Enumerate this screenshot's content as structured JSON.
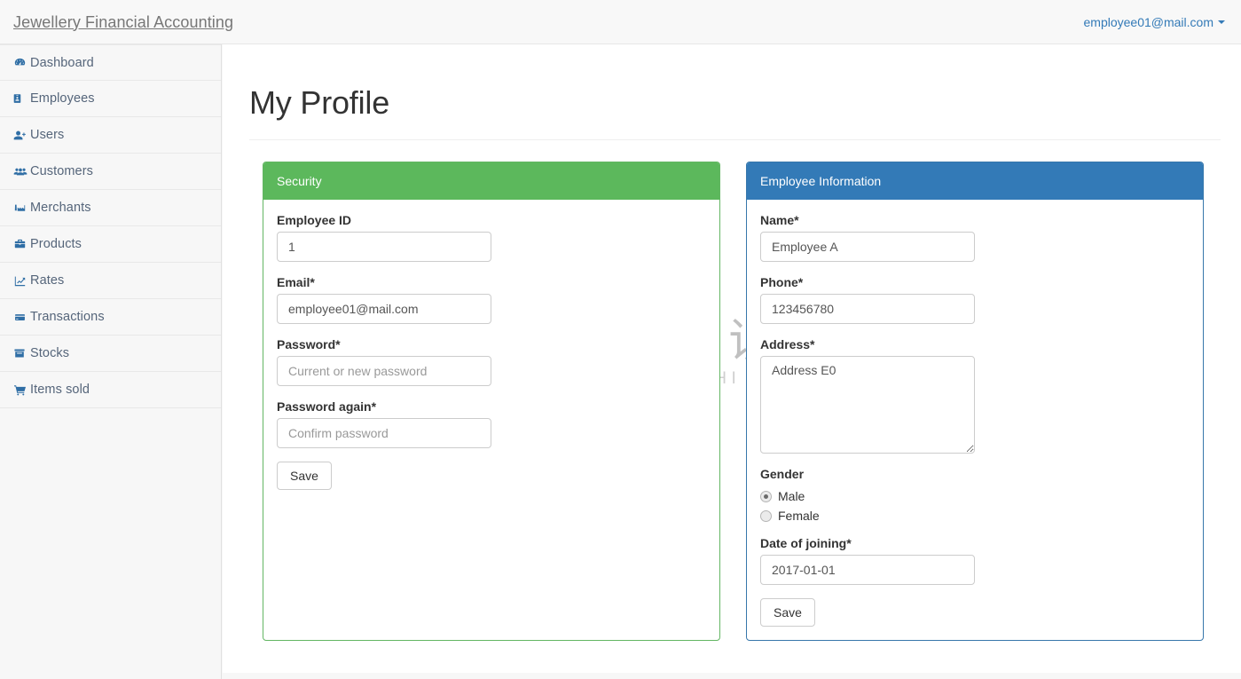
{
  "navbar": {
    "brand": "Jewellery Financial Accounting",
    "user_email": "employee01@mail.com",
    "caret_icon": "caret-down-icon"
  },
  "sidebar": {
    "items": [
      {
        "label": "Dashboard",
        "icon": "dashboard-icon"
      },
      {
        "label": "Employees",
        "icon": "id-badge-icon"
      },
      {
        "label": "Users",
        "icon": "user-plus-icon"
      },
      {
        "label": "Customers",
        "icon": "users-group-icon"
      },
      {
        "label": "Merchants",
        "icon": "industry-icon"
      },
      {
        "label": "Products",
        "icon": "briefcase-icon"
      },
      {
        "label": "Rates",
        "icon": "line-chart-icon"
      },
      {
        "label": "Transactions",
        "icon": "credit-card-icon"
      },
      {
        "label": "Stocks",
        "icon": "archive-icon"
      },
      {
        "label": "Items sold",
        "icon": "shopping-cart-icon"
      }
    ]
  },
  "main": {
    "page_title": "My Profile"
  },
  "security_panel": {
    "heading": "Security",
    "accent_color": "#5cb85c",
    "fields": {
      "employee_id_label": "Employee ID",
      "employee_id_value": "1",
      "email_label": "Email*",
      "email_value": "employee01@mail.com",
      "password_label": "Password*",
      "password_placeholder": "Current or new password",
      "password_value": "",
      "password_again_label": "Password again*",
      "password_again_placeholder": "Confirm password",
      "password_again_value": ""
    },
    "save_label": "Save"
  },
  "employee_panel": {
    "heading": "Employee Information",
    "accent_color": "#337ab7",
    "fields": {
      "name_label": "Name*",
      "name_value": "Employee A",
      "phone_label": "Phone*",
      "phone_value": "123456780",
      "address_label": "Address*",
      "address_value": "Address E0",
      "gender_label": "Gender",
      "gender_options": [
        {
          "label": "Male",
          "selected": true
        },
        {
          "label": "Female",
          "selected": false
        }
      ],
      "date_of_joining_label": "Date of joining*",
      "date_of_joining_value": "2017-01-01"
    },
    "save_label": "Save"
  },
  "watermark": {
    "cn_text": "小牛知识库",
    "en_text": "XIAO NIU ZHI SHI KU",
    "logo_icon": "ox-circle-logo-icon"
  }
}
